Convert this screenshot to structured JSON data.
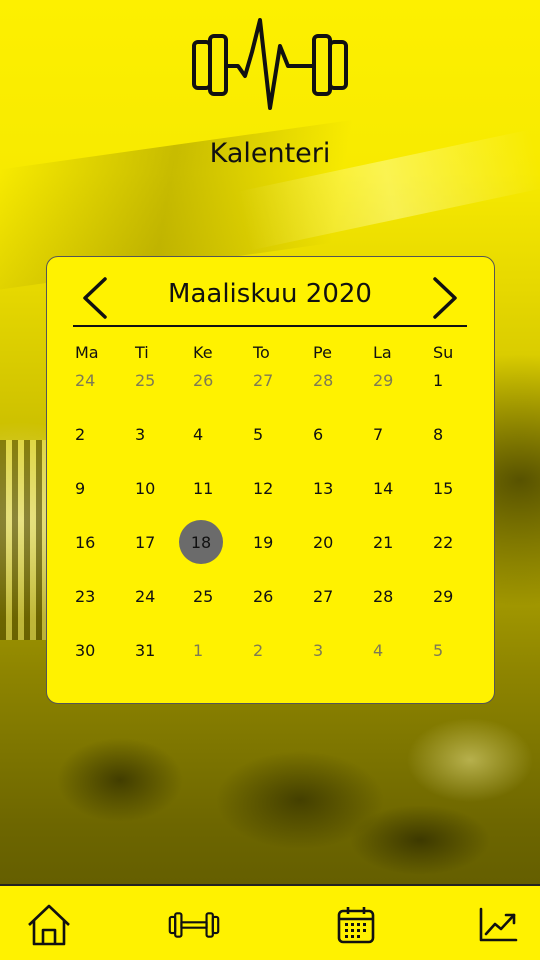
{
  "header": {
    "title": "Kalenteri",
    "logo_icon": "dumbbell-heartbeat-icon"
  },
  "calendar": {
    "month_label": "Maaliskuu 2020",
    "prev_icon": "chevron-left-icon",
    "next_icon": "chevron-right-icon",
    "weekdays": [
      "Ma",
      "Ti",
      "Ke",
      "To",
      "Pe",
      "La",
      "Su"
    ],
    "weeks": [
      [
        {
          "d": "24",
          "muted": true
        },
        {
          "d": "25",
          "muted": true
        },
        {
          "d": "26",
          "muted": true
        },
        {
          "d": "27",
          "muted": true
        },
        {
          "d": "28",
          "muted": true
        },
        {
          "d": "29",
          "muted": true
        },
        {
          "d": "1",
          "muted": false
        }
      ],
      [
        {
          "d": "2",
          "muted": false
        },
        {
          "d": "3",
          "muted": false
        },
        {
          "d": "4",
          "muted": false
        },
        {
          "d": "5",
          "muted": false
        },
        {
          "d": "6",
          "muted": false
        },
        {
          "d": "7",
          "muted": false
        },
        {
          "d": "8",
          "muted": false
        }
      ],
      [
        {
          "d": "9",
          "muted": false
        },
        {
          "d": "10",
          "muted": false
        },
        {
          "d": "11",
          "muted": false
        },
        {
          "d": "12",
          "muted": false
        },
        {
          "d": "13",
          "muted": false
        },
        {
          "d": "14",
          "muted": false
        },
        {
          "d": "15",
          "muted": false
        }
      ],
      [
        {
          "d": "16",
          "muted": false
        },
        {
          "d": "17",
          "muted": false
        },
        {
          "d": "18",
          "muted": false,
          "selected": true
        },
        {
          "d": "19",
          "muted": false
        },
        {
          "d": "20",
          "muted": false
        },
        {
          "d": "21",
          "muted": false
        },
        {
          "d": "22",
          "muted": false
        }
      ],
      [
        {
          "d": "23",
          "muted": false
        },
        {
          "d": "24",
          "muted": false
        },
        {
          "d": "25",
          "muted": false
        },
        {
          "d": "26",
          "muted": false
        },
        {
          "d": "27",
          "muted": false
        },
        {
          "d": "28",
          "muted": false
        },
        {
          "d": "29",
          "muted": false
        }
      ],
      [
        {
          "d": "30",
          "muted": false
        },
        {
          "d": "31",
          "muted": false
        },
        {
          "d": "1",
          "muted": true
        },
        {
          "d": "2",
          "muted": true
        },
        {
          "d": "3",
          "muted": true
        },
        {
          "d": "4",
          "muted": true
        },
        {
          "d": "5",
          "muted": true
        }
      ]
    ],
    "selected_day": "18"
  },
  "bottom_nav": {
    "items": [
      {
        "name": "home",
        "icon": "home-icon"
      },
      {
        "name": "workouts",
        "icon": "dumbbell-icon"
      },
      {
        "name": "calendar",
        "icon": "calendar-icon"
      },
      {
        "name": "progress",
        "icon": "chart-trend-icon"
      }
    ]
  },
  "colors": {
    "accent": "#fff200",
    "selected": "#6b6b6b",
    "text": "#111111",
    "muted_text": "#7d7a55"
  }
}
